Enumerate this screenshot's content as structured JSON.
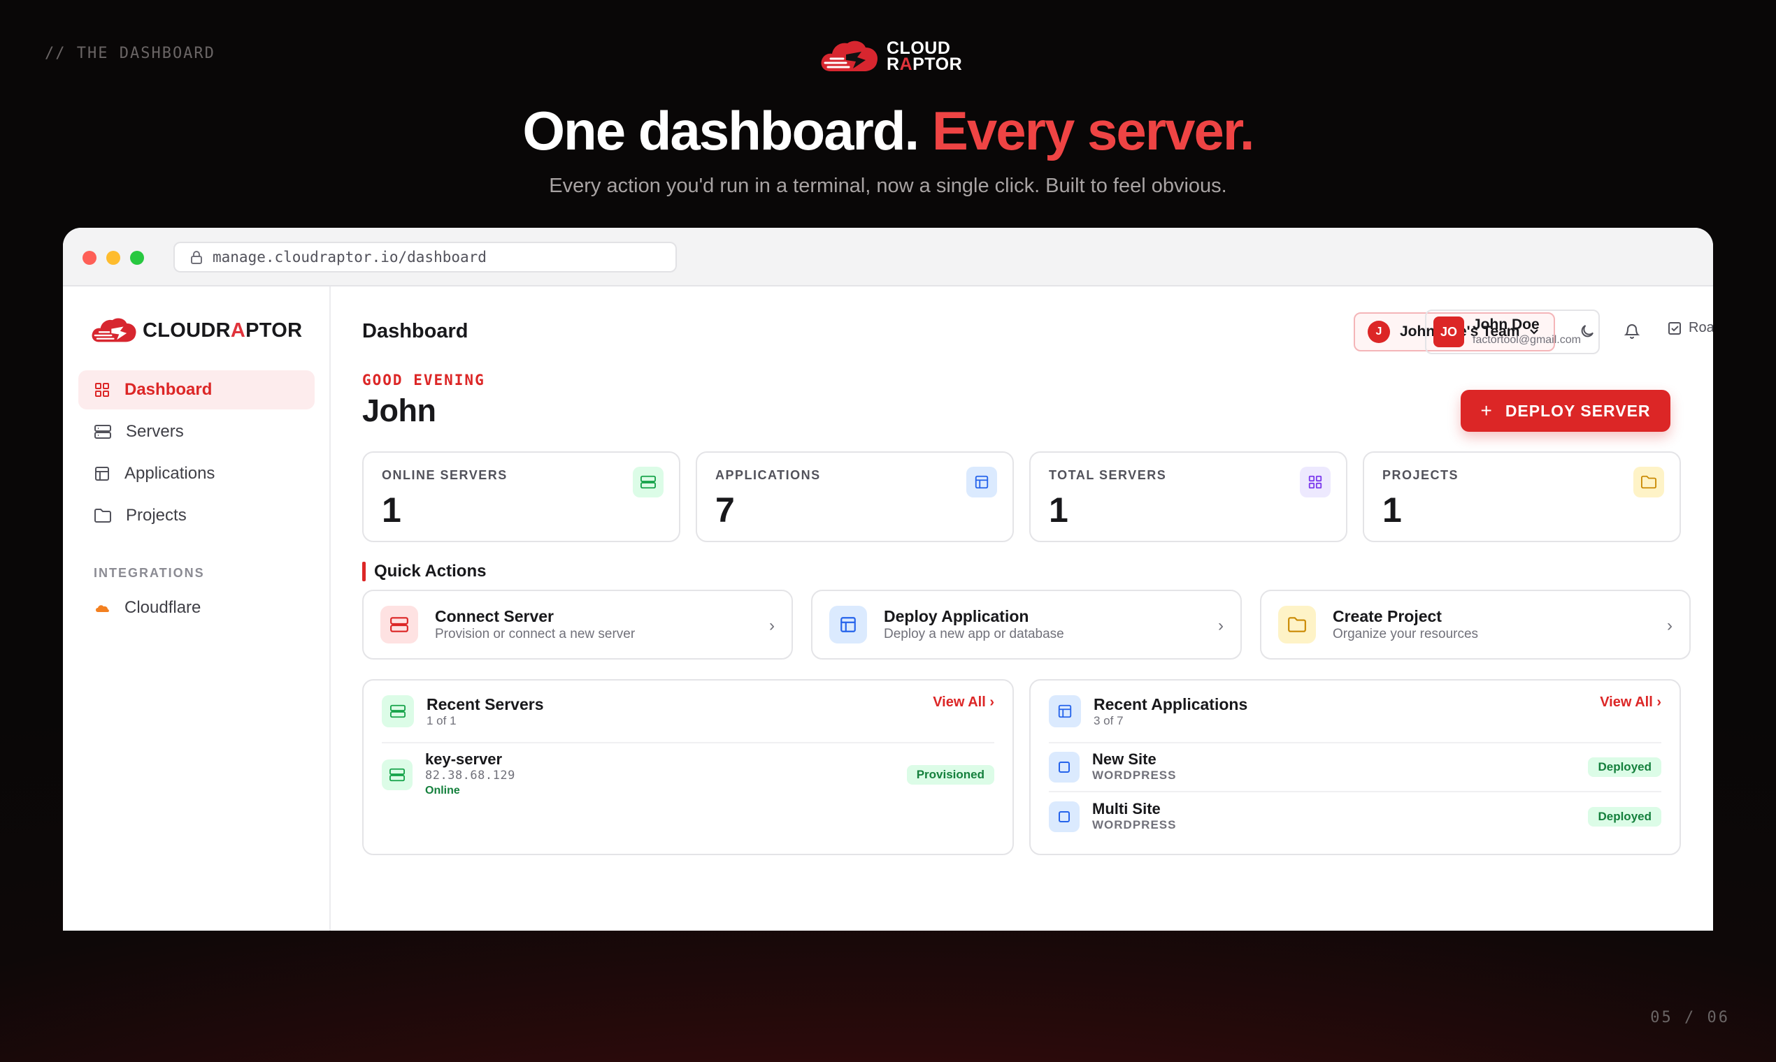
{
  "slide": {
    "tag": "// THE DASHBOARD",
    "counter": "05 / 06",
    "logo_line1": "CLOUD",
    "logo_line2_r": "R",
    "logo_line2_a": "A",
    "logo_line2_rest": "PTOR",
    "title_main": "One dashboard.",
    "title_accent": "Every server.",
    "subtitle": "Every action you'd run in a terminal, now a single click. Built to feel obvious."
  },
  "browser": {
    "url": "manage.cloudraptor.io/dashboard"
  },
  "sidebar": {
    "logo_part1": "CLOUDR",
    "logo_part2": "A",
    "logo_part3": "PTOR",
    "items": [
      {
        "label": "Dashboard",
        "icon": "grid-icon",
        "active": true
      },
      {
        "label": "Servers",
        "icon": "server-icon"
      },
      {
        "label": "Applications",
        "icon": "layout-icon"
      },
      {
        "label": "Projects",
        "icon": "folder-icon"
      }
    ],
    "section_label": "INTEGRATIONS",
    "integration": {
      "label": "Cloudflare",
      "icon": "cloud-icon",
      "color": "#f38020"
    }
  },
  "header": {
    "page_title": "Dashboard",
    "team_badge": "J",
    "team_name": "John Doe's Team",
    "roadmap_label": "Roadmap",
    "user_initials": "JO",
    "user_name": "John Doe",
    "user_email": "factortool@gmail.com"
  },
  "greeting": {
    "label": "GOOD EVENING",
    "name": "John",
    "deploy_plus": "+",
    "deploy_label": "DEPLOY SERVER"
  },
  "stats": [
    {
      "label": "ONLINE SERVERS",
      "value": "1",
      "icon": "server-icon",
      "color": "#16a34a"
    },
    {
      "label": "APPLICATIONS",
      "value": "7",
      "icon": "layout-icon",
      "color": "#2563eb"
    },
    {
      "label": "TOTAL SERVERS",
      "value": "1",
      "icon": "grid-icon",
      "color": "#7c3aed"
    },
    {
      "label": "PROJECTS",
      "value": "1",
      "icon": "folder-icon",
      "color": "#ca8a04"
    }
  ],
  "quick_actions": {
    "title": "Quick Actions",
    "items": [
      {
        "name": "Connect Server",
        "desc": "Provision or connect a new server",
        "icon": "server-icon"
      },
      {
        "name": "Deploy Application",
        "desc": "Deploy a new app or database",
        "icon": "layout-icon"
      },
      {
        "name": "Create Project",
        "desc": "Organize your resources",
        "icon": "folder-icon"
      }
    ]
  },
  "recent_servers": {
    "title": "Recent Servers",
    "count": "1 of 1",
    "view_all": "View All ›",
    "rows": [
      {
        "name": "key-server",
        "ip": "82.38.68.129",
        "status": "Online",
        "badge": "Provisioned"
      }
    ]
  },
  "recent_apps": {
    "title": "Recent Applications",
    "count": "3 of 7",
    "view_all": "View All ›",
    "rows": [
      {
        "name": "New Site",
        "type": "WORDPRESS",
        "badge": "Deployed"
      },
      {
        "name": "Multi Site",
        "type": "WORDPRESS",
        "badge": "Deployed"
      }
    ]
  }
}
